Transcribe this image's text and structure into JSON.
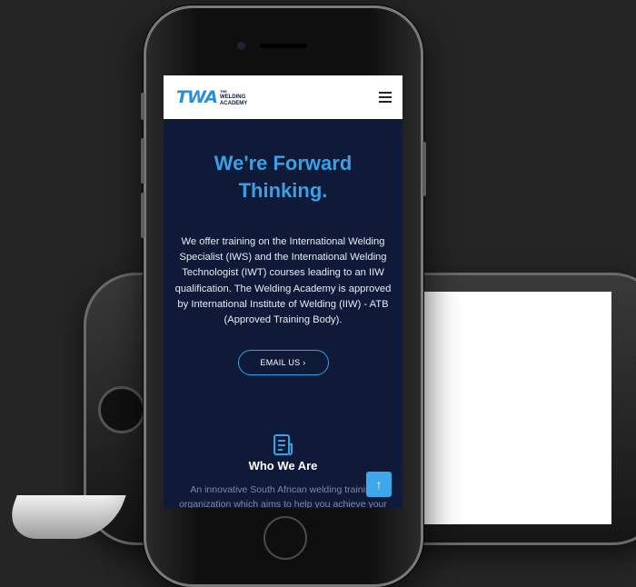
{
  "site": {
    "logo_mark": "TWA",
    "logo_small": "THE",
    "logo_line1": "WELDING",
    "logo_line2": "ACADEMY"
  },
  "hero": {
    "title": "We're Forward Thinking.",
    "body": "We offer training on the International Welding Specialist (IWS) and the International Welding Technologist (IWT) courses leading to an IIW qualification. The Welding Academy is approved by International Institute of Welding (IIW) - ATB (Approved Training Body).",
    "cta_label": "EMAIL US  ›"
  },
  "who": {
    "title": "Who We Are",
    "body": "An innovative South African welding training organization which aims to help you achieve your"
  },
  "icons": {
    "menu": "hamburger-menu-icon",
    "document": "document-icon",
    "scroll_top": "arrow-up-icon",
    "side": [
      "hex-nut-icon",
      "hex-nut-icon",
      "bolt-icon",
      "clamp-icon"
    ]
  },
  "colors": {
    "accent": "#2fa3e3",
    "navy": "#0e1a38",
    "background": "#252525"
  }
}
